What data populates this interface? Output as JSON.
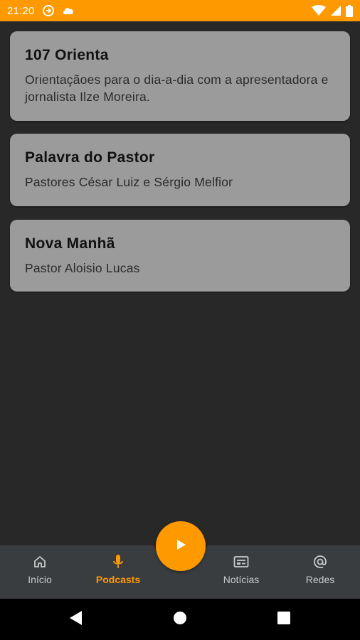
{
  "status_bar": {
    "time": "21:20",
    "icons": [
      "data-saver-icon",
      "cloud-icon",
      "wifi-icon",
      "signal-icon",
      "battery-icon"
    ]
  },
  "colors": {
    "accent": "#FF9900",
    "background": "#282828",
    "card": "#9b9b9b",
    "nav_background": "#3a3d40"
  },
  "podcasts": [
    {
      "title": "107 Orienta",
      "subtitle": "Orientaçãoes para o dia-a-dia com a apresentadora e jornalista Ilze Moreira."
    },
    {
      "title": "Palavra do Pastor",
      "subtitle": "Pastores César Luiz e Sérgio Melfior"
    },
    {
      "title": "Nova Manhã",
      "subtitle": "Pastor Aloisio Lucas"
    }
  ],
  "bottom_nav": {
    "items": [
      {
        "label": "Início",
        "icon": "home-icon",
        "active": false
      },
      {
        "label": "Podcasts",
        "icon": "microphone-icon",
        "active": true
      },
      {
        "label": "Notícias",
        "icon": "news-icon",
        "active": false
      },
      {
        "label": "Redes",
        "icon": "at-icon",
        "active": false
      }
    ],
    "play_icon": "play-icon"
  },
  "system_nav": {
    "icons": [
      "back-icon",
      "home-circle-icon",
      "recents-icon"
    ]
  }
}
